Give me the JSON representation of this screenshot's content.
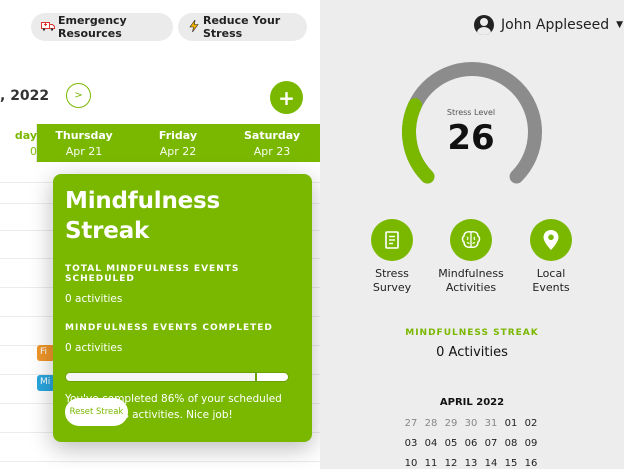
{
  "header": {
    "emergency_label": "Emergency Resources",
    "emergency_icon": "ambulance-icon",
    "stress_label": "Reduce Your Stress",
    "stress_icon": "lightning-icon"
  },
  "calendar": {
    "month_title": ", 2022",
    "next_label": ">",
    "add_label": "+",
    "days": [
      {
        "name": "day",
        "date": "0"
      },
      {
        "name": "Thursday",
        "date": "Apr 21"
      },
      {
        "name": "Friday",
        "date": "Apr 22"
      },
      {
        "name": "Saturday",
        "date": "Apr 23"
      }
    ],
    "tags": [
      {
        "text": "Fi",
        "color": "#f0962a"
      },
      {
        "text": "Mi",
        "color": "#29a6de"
      }
    ]
  },
  "popup": {
    "title": "Mindfulness Streak",
    "scheduled_label": "TOTAL MINDFULNESS EVENTS SCHEDULED",
    "scheduled_value": "0 activities",
    "completed_label": "MINDFULNESS EVENTS COMPLETED",
    "completed_value": "0 activities",
    "progress": 0.86,
    "message": "You've completed 86% of your scheduled mindfulness activities. Nice job!",
    "reset_label": "Reset Streak"
  },
  "sidebar": {
    "user_name": "John Appleseed",
    "stress": {
      "label": "Stress Level",
      "value": "26",
      "level_fraction": 0.26
    },
    "actions": [
      {
        "label_line1": "Stress",
        "label_line2": "Survey",
        "icon": "survey-icon"
      },
      {
        "label_line1": "Mindfulness",
        "label_line2": "Activities",
        "icon": "brain-icon"
      },
      {
        "label_line1": "Local",
        "label_line2": "Events",
        "icon": "location-pin-icon"
      }
    ],
    "streak_label": "MINDFULNESS STREAK",
    "streak_value": "0 Activities",
    "mini_calendar": {
      "title": "APRIL 2022",
      "rows": [
        [
          "27",
          "28",
          "29",
          "30",
          "31",
          "01",
          "02"
        ],
        [
          "03",
          "04",
          "05",
          "06",
          "07",
          "08",
          "09"
        ],
        [
          "10",
          "11",
          "12",
          "13",
          "14",
          "15",
          "16"
        ]
      ]
    }
  },
  "colors": {
    "accent": "#7ab800",
    "gauge_track": "#8c8c8c",
    "panel_bg": "#ededed"
  }
}
